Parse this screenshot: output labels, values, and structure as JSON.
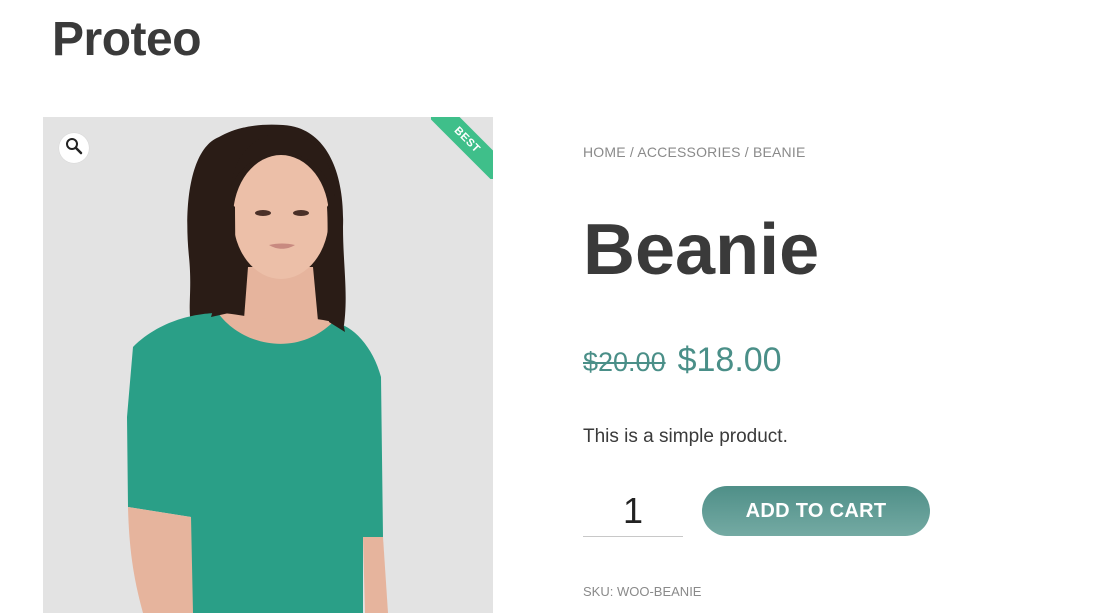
{
  "site": {
    "title": "Proteo"
  },
  "gallery": {
    "zoom_icon": "magnifier-icon",
    "badge": "BEST",
    "badge_color": "#3fbf8a",
    "image_alt": "Woman in green short-sleeve top"
  },
  "breadcrumb": {
    "home": "HOME",
    "sep1": " / ",
    "category": "ACCESSORIES",
    "sep2": " / ",
    "current": "BEANIE"
  },
  "product": {
    "title": "Beanie",
    "regular_price": "$20.00",
    "sale_price": "$18.00",
    "price_color": "#4a8f88",
    "short_description": "This is a simple product.",
    "quantity": "1",
    "add_to_cart_label": "ADD TO CART",
    "button_color": "#5a9a93",
    "sku_label": "SKU:",
    "sku_value": "WOO-BEANIE"
  }
}
